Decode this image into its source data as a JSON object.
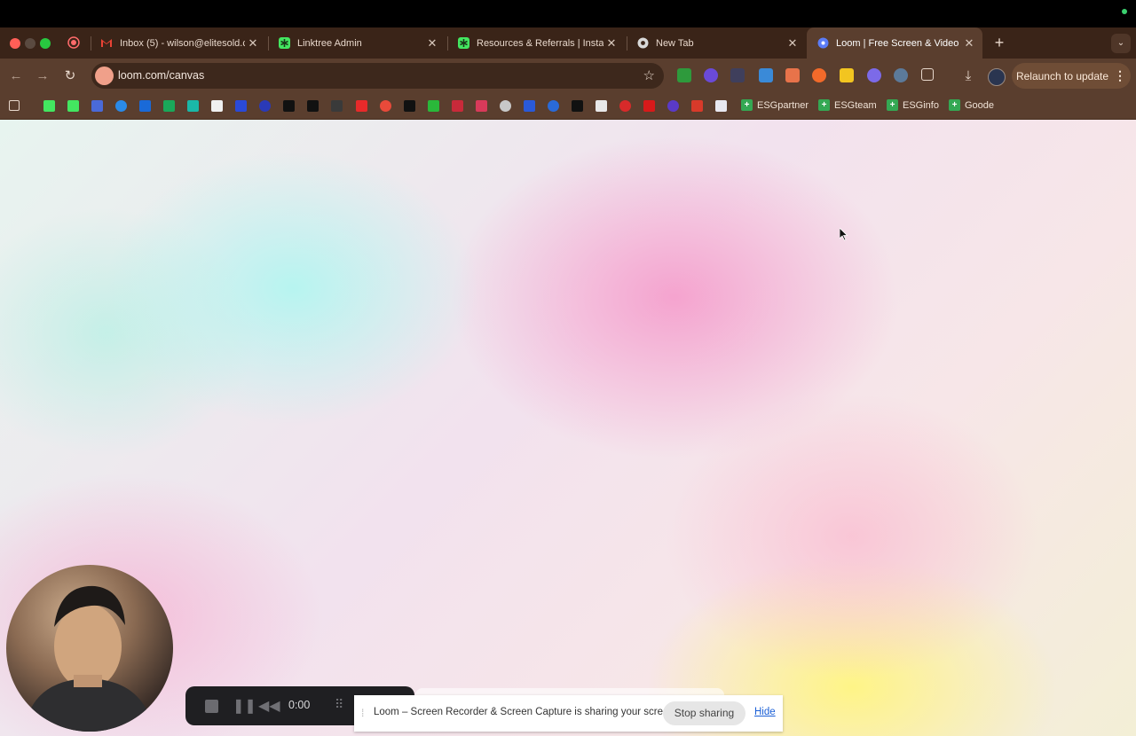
{
  "tabs": [
    {
      "title": "Inbox (5) - wilson@elitesold.c",
      "icon": "gmail-icon",
      "active": false
    },
    {
      "title": "Linktree Admin",
      "icon": "linktree-icon",
      "active": false
    },
    {
      "title": "Resources & Referrals | Instag",
      "icon": "linktree-icon",
      "active": false
    },
    {
      "title": "New Tab",
      "icon": "chrome-icon",
      "active": false
    },
    {
      "title": "Loom | Free Screen & Video R",
      "icon": "loom-icon",
      "active": true
    }
  ],
  "address_bar": {
    "url": "loom.com/canvas"
  },
  "toolbar": {
    "relaunch_label": "Relaunch to update"
  },
  "bookmarks": [
    {
      "label": "ESGpartner"
    },
    {
      "label": "ESGteam"
    },
    {
      "label": "ESGinfo"
    },
    {
      "label": "Goode"
    }
  ],
  "loom_controls": {
    "timer": "0:00"
  },
  "share_notice": {
    "message": "Loom – Screen Recorder & Screen Capture is sharing your screen.",
    "stop_label": "Stop sharing",
    "hide_label": "Hide"
  },
  "colors": {
    "titlebar": "#3a2418",
    "toolbar": "#5a3e2e",
    "relaunch": "#6f4d36",
    "accent_link": "#1a5fd6"
  }
}
